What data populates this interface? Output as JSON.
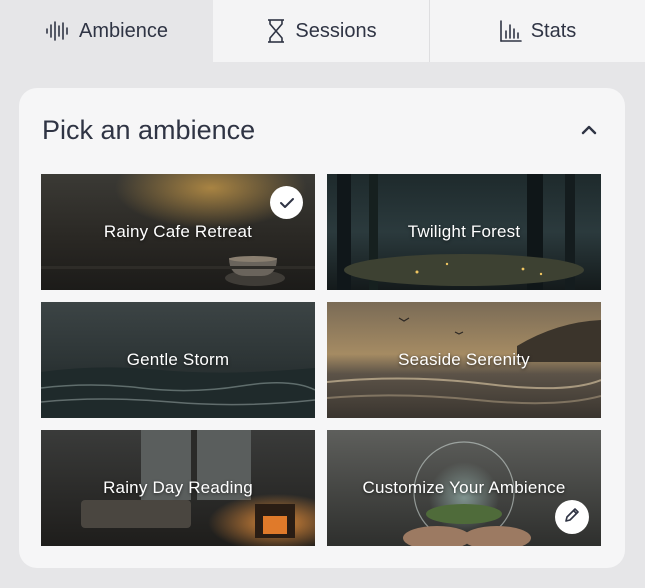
{
  "tabs": [
    {
      "label": "Ambience",
      "icon": "waveform-icon",
      "active": true
    },
    {
      "label": "Sessions",
      "icon": "hourglass-icon",
      "active": false
    },
    {
      "label": "Stats",
      "icon": "bar-chart-icon",
      "active": false
    }
  ],
  "panel": {
    "title": "Pick an ambience",
    "collapse_icon": "chevron-up-icon"
  },
  "ambiences": [
    {
      "label": "Rainy Cafe Retreat",
      "selected": true
    },
    {
      "label": "Twilight Forest",
      "selected": false
    },
    {
      "label": "Gentle Storm",
      "selected": false
    },
    {
      "label": "Seaside Serenity",
      "selected": false
    },
    {
      "label": "Rainy Day Reading",
      "selected": false
    },
    {
      "label": "Customize Your Ambience",
      "selected": false,
      "edit_icon": "pencil-icon"
    }
  ],
  "colors": {
    "accent_text": "#2f3444",
    "background": "#e6e6e8",
    "card": "#f6f6f7"
  }
}
